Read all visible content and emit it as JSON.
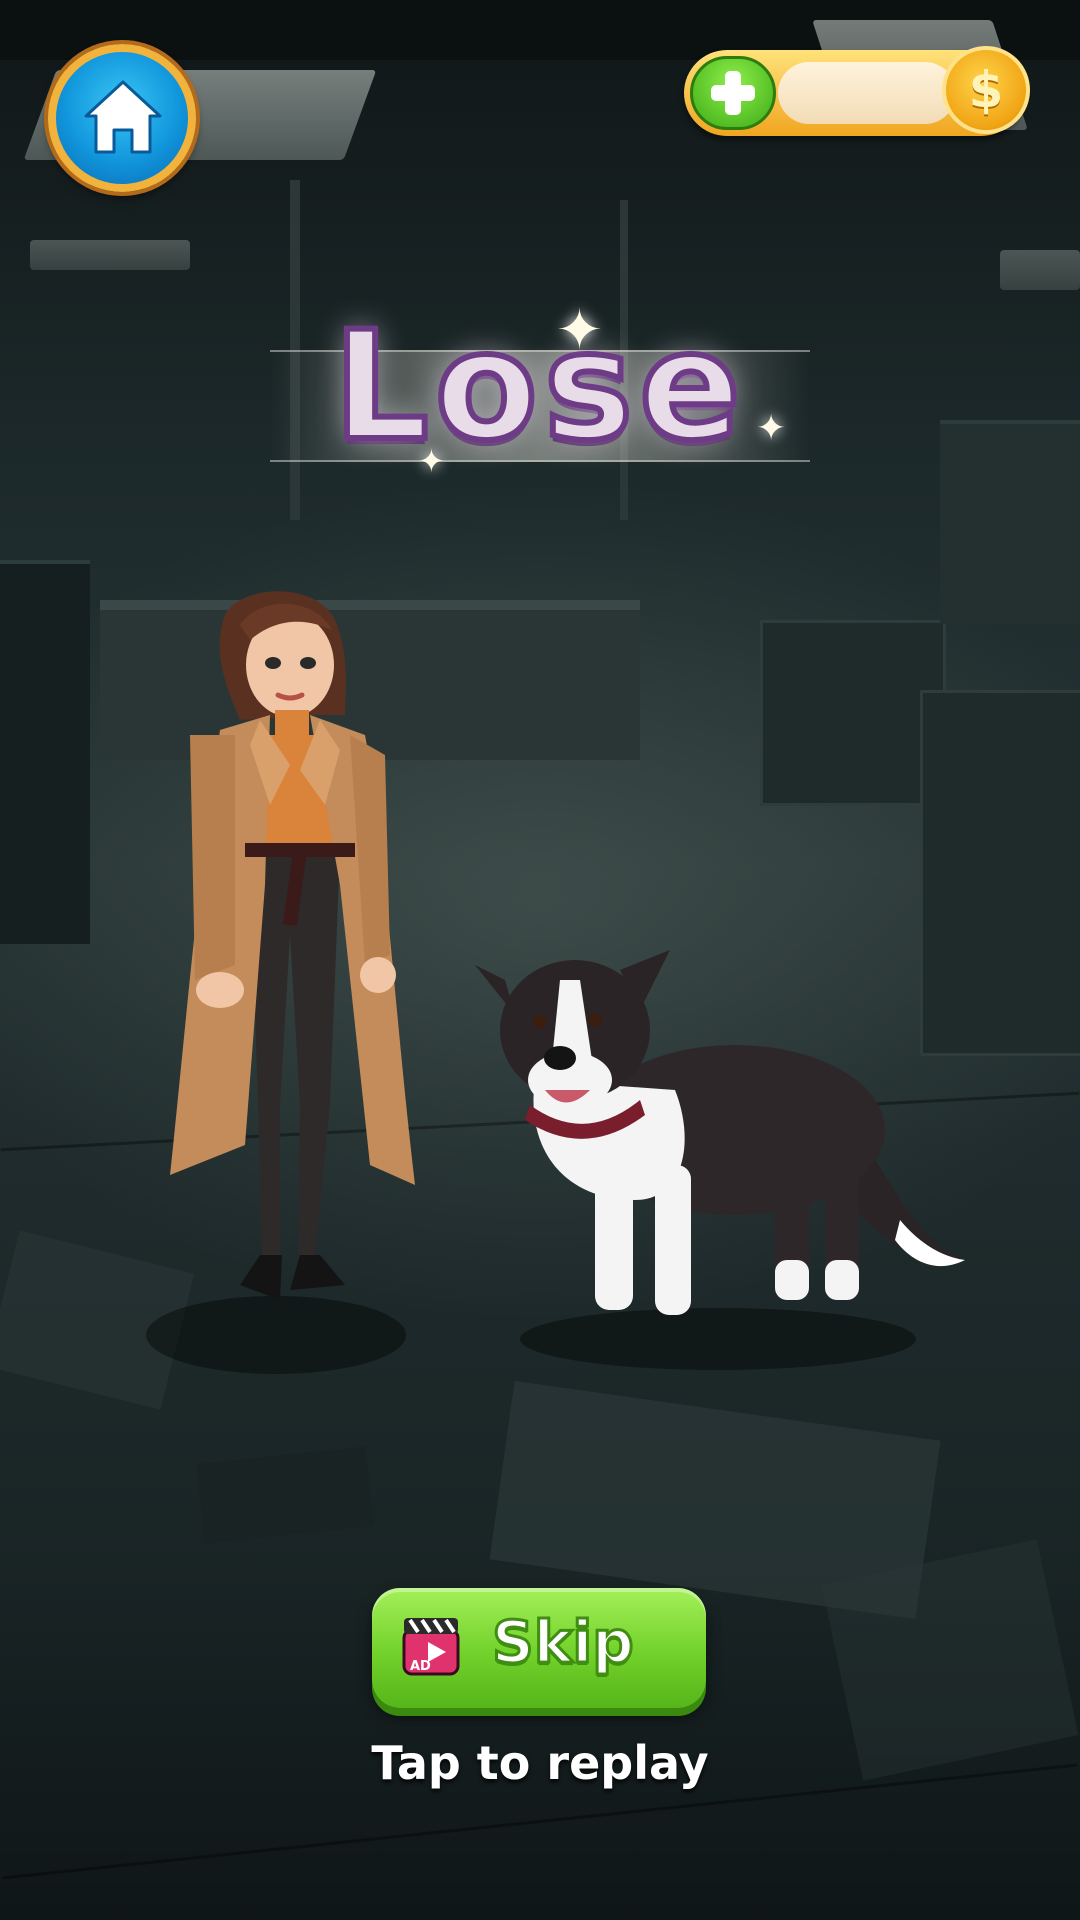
{
  "hud": {
    "home_icon": "home-icon",
    "add_icon": "plus-icon",
    "coin_icon": "dollar-coin-icon",
    "coin_symbol": "$",
    "coin_count": ""
  },
  "result": {
    "title": "Lose"
  },
  "actions": {
    "skip_label": "Skip",
    "ad_badge": "AD",
    "replay_prompt": "Tap to replay"
  },
  "colors": {
    "title_fill": "#e8dce8",
    "title_outline": "#6e3b87",
    "skip_green": "#72d12a",
    "home_blue": "#1196dc",
    "coin_gold": "#f0a414"
  }
}
